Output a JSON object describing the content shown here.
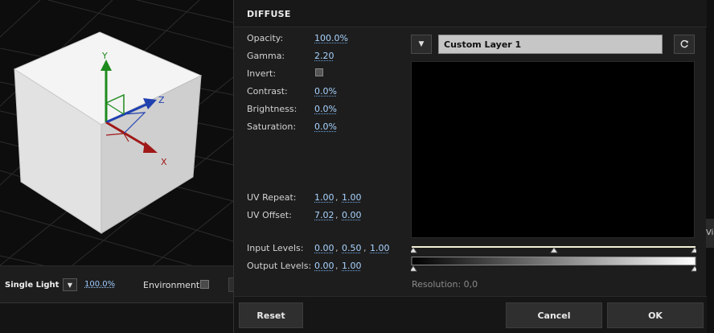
{
  "viewport": {
    "axes": {
      "x": "X",
      "y": "Y",
      "z": "Z"
    },
    "colors": {
      "x_axis": "#a01818",
      "y_axis": "#1e8a1e",
      "z_axis": "#2040b0",
      "background": "#0d0d0d",
      "cube": "#e8e8e8"
    },
    "toolbar": {
      "light_mode": "Single Light",
      "light_intensity": "100.0%",
      "environment_label": "Environment"
    }
  },
  "right_edge": {
    "peek_text": "Vie"
  },
  "dialog": {
    "title": "DIFFUSE",
    "properties": {
      "opacity": {
        "label": "Opacity:",
        "value": "100.0%"
      },
      "gamma": {
        "label": "Gamma:",
        "value": "2.20"
      },
      "invert": {
        "label": "Invert:"
      },
      "contrast": {
        "label": "Contrast:",
        "value": "0.0%"
      },
      "brightness": {
        "label": "Brightness:",
        "value": "0.0%"
      },
      "saturation": {
        "label": "Saturation:",
        "value": "0.0%"
      },
      "uv_repeat": {
        "label": "UV Repeat:",
        "values": [
          "1.00",
          "1.00"
        ]
      },
      "uv_offset": {
        "label": "UV Offset:",
        "values": [
          "7.02",
          "0.00"
        ]
      },
      "input_levels": {
        "label": "Input Levels:",
        "values": [
          "0.00",
          "0.50",
          "1.00"
        ]
      },
      "output_levels": {
        "label": "Output Levels:",
        "values": [
          "0.00",
          "1.00"
        ]
      }
    },
    "separator": ",",
    "layer": {
      "name": "Custom Layer 1"
    },
    "resolution": "Resolution: 0,0",
    "levels": {
      "input_markers": [
        0.0,
        0.5,
        1.0
      ],
      "output_markers": [
        0.0,
        1.0
      ]
    },
    "buttons": {
      "reset": "Reset",
      "cancel": "Cancel",
      "ok": "OK"
    },
    "colors": {
      "accent_value": "#a9d3ff",
      "panel": "#1d1d1d",
      "preview": "#000000"
    }
  }
}
